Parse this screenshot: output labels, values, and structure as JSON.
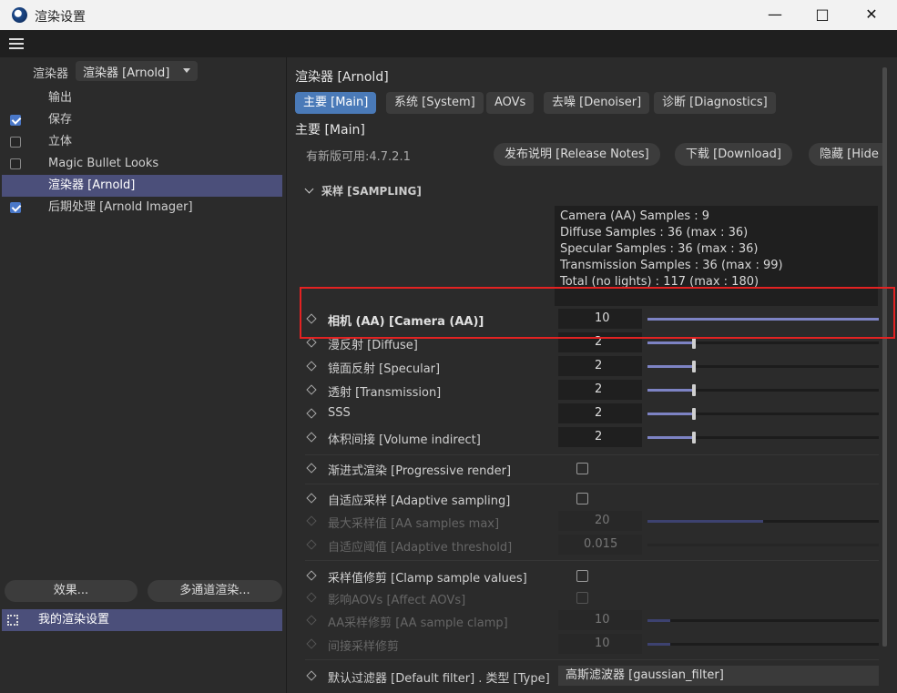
{
  "window": {
    "title": "渲染设置",
    "min_icon": "minimize-icon",
    "max_icon": "maximize-icon",
    "close_icon": "close-icon"
  },
  "left": {
    "renderer_label": "渲染器",
    "renderer_value": "渲染器 [Arnold]",
    "items": [
      {
        "label": "输出",
        "checkbox": null
      },
      {
        "label": "保存",
        "checkbox": true
      },
      {
        "label": "立体",
        "checkbox": false
      },
      {
        "label": "Magic Bullet Looks",
        "checkbox": false
      },
      {
        "label": "渲染器 [Arnold]",
        "checkbox": null,
        "selected": true
      },
      {
        "label": "后期处理 [Arnold Imager]",
        "checkbox": true
      }
    ],
    "effects_button": "效果...",
    "multipass_button": "多通道渲染...",
    "my_settings": "我的渲染设置"
  },
  "right": {
    "title": "渲染器 [Arnold]",
    "tabs": [
      "主要 [Main]",
      "系统 [System]",
      "AOVs",
      "去噪 [Denoiser]",
      "诊断 [Diagnostics]"
    ],
    "active_tab": 0,
    "section_title": "主要 [Main]",
    "version_text": "有新版可用:4.7.2.1",
    "release_notes": "发布说明 [Release Notes]",
    "download": "下载 [Download]",
    "hide": "隐藏 [Hide",
    "group": "采样 [SAMPLING]",
    "info": [
      "Camera (AA) Samples : 9",
      "Diffuse Samples : 36 (max : 36)",
      "Specular Samples : 36 (max : 36)",
      "Transmission Samples : 36 (max : 99)",
      "Total (no lights) : 117 (max : 180)"
    ],
    "rows": {
      "camera": {
        "label": "相机 (AA) [Camera (AA)]",
        "value": "10"
      },
      "diffuse": {
        "label": "漫反射 [Diffuse]",
        "value": "2"
      },
      "specular": {
        "label": "镜面反射 [Specular]",
        "value": "2"
      },
      "transmission": {
        "label": "透射 [Transmission]",
        "value": "2"
      },
      "sss": {
        "label": "SSS",
        "value": "2"
      },
      "volume": {
        "label": "体积间接 [Volume indirect]",
        "value": "2"
      },
      "progressive": {
        "label": "渐进式渲染 [Progressive render]"
      },
      "adaptive": {
        "label": "自适应采样 [Adaptive sampling]"
      },
      "aa_max": {
        "label": "最大采样值 [AA samples max]",
        "value": "20"
      },
      "adaptive_threshold": {
        "label": "自适应阈值 [Adaptive threshold]",
        "value": "0.015"
      },
      "clamp": {
        "label": "采样值修剪 [Clamp sample values]"
      },
      "affect_aovs": {
        "label": "影响AOVs [Affect AOVs]"
      },
      "aa_clamp": {
        "label": "AA采样修剪 [AA sample clamp]",
        "value": "10"
      },
      "indirect_clamp": {
        "label": "间接采样修剪",
        "value": "10"
      },
      "filter": {
        "label": "默认过滤器 [Default filter] . 类型 [Type]",
        "value": "高斯滤波器 [gaussian_filter]"
      }
    },
    "slider_levels": {
      "camera": 1.0,
      "diffuse": 0.2,
      "specular": 0.2,
      "transmission": 0.2,
      "sss": 0.2,
      "volume": 0.2,
      "aa_max": 0.5,
      "aa_clamp": 0.1,
      "indirect_clamp": 0.1
    },
    "highlight_color": "#e32222",
    "accent": "#4a7ab8"
  }
}
